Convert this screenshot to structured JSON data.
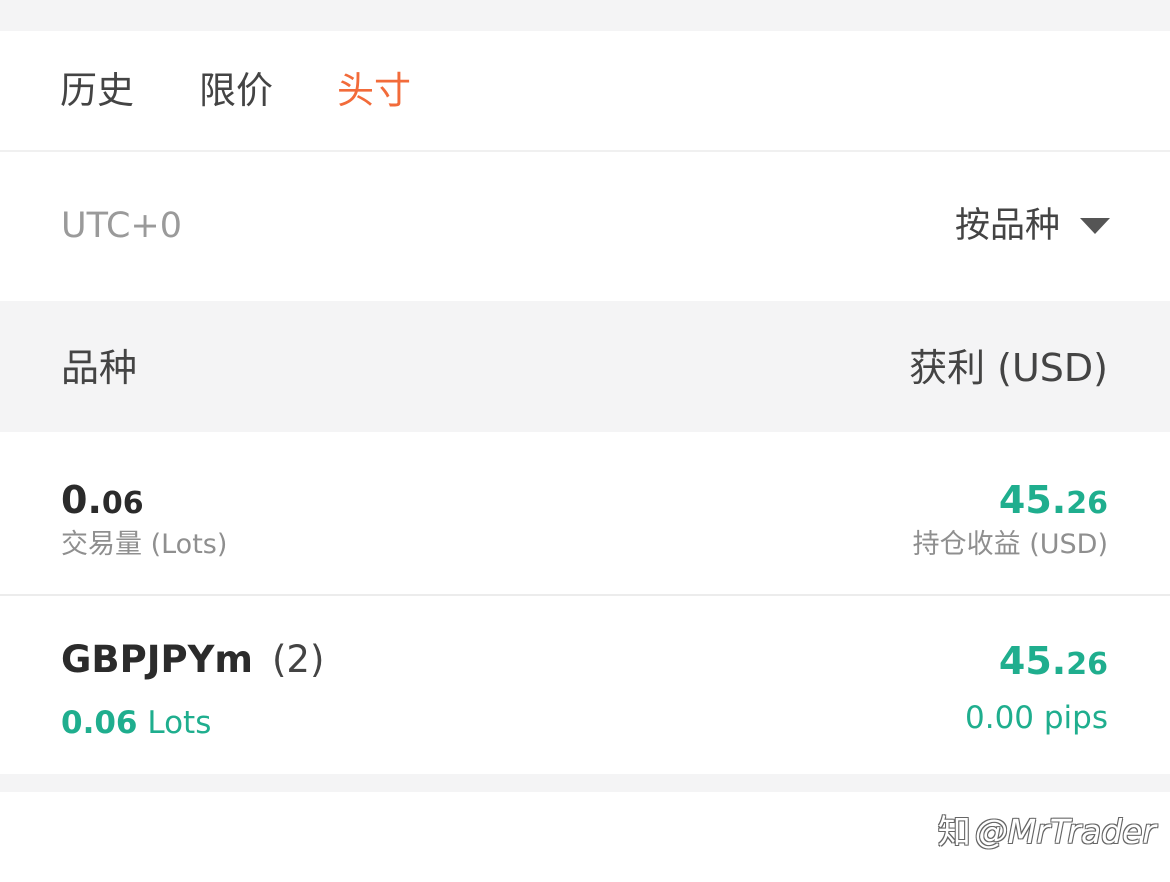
{
  "tabs": [
    {
      "label": "历史",
      "active": false
    },
    {
      "label": "限价",
      "active": false
    },
    {
      "label": "头寸",
      "active": true
    }
  ],
  "colors": {
    "accent": "#f26b3a",
    "profit": "#1fae8e",
    "text": "#2b2b2b",
    "muted": "#8f8f8f",
    "section_bg": "#f4f4f5"
  },
  "filter": {
    "timezone": "UTC+0",
    "sort_label": "按品种",
    "sort_icon": "caret-down-icon"
  },
  "header": {
    "left": "品种",
    "right": "获利 (USD)"
  },
  "summary": {
    "volume_int": "0.",
    "volume_dec": "06",
    "volume_label": "交易量 (Lots)",
    "profit_int": "45.",
    "profit_dec": "26",
    "profit_label": "持仓收益 (USD)"
  },
  "positions": [
    {
      "symbol": "GBPJPYm",
      "count": "(2)",
      "lots_value": "0.06",
      "lots_unit": " Lots",
      "profit_int": "45.",
      "profit_dec": "26",
      "pips": "0.00 pips"
    }
  ],
  "watermark": {
    "logo": "知",
    "text": "@MrTrader"
  }
}
